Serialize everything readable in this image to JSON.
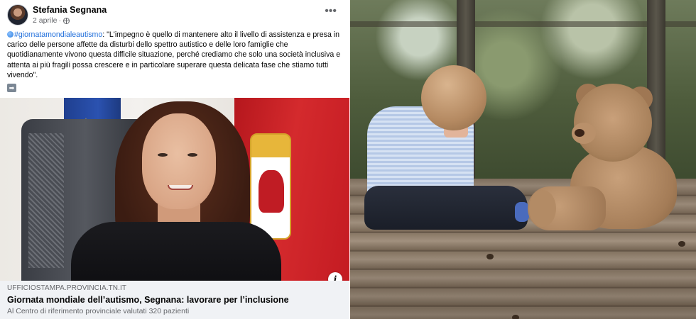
{
  "post": {
    "author": "Stefania Segnana",
    "date": "2 aprile",
    "separator": "·",
    "more_label": "•••",
    "hashtag": "#giornatamondialeautismo",
    "body": ": \"L'impegno è quello di mantenere alto il livello di assistenza e presa in carico delle persone affette da disturbi dello spettro autistico e delle loro famiglie che quotidianamente vivono questa difficile situazione, perché crediamo che solo una società inclusiva e attenta ai più fragili possa crescere e in particolare superare questa delicata fase che stiamo tutti vivendo\".",
    "arrow_glyph": "➡"
  },
  "link_preview": {
    "domain": "UFFICIOSTAMPA.PROVINCIA.TN.IT",
    "title": "Giornata mondiale dell’autismo, Segnana: lavorare per l’inclusione",
    "subtitle": "Al Centro di riferimento provinciale valutati 320 pazienti",
    "info_glyph": "i"
  },
  "colors": {
    "hashtag": "#216fdb",
    "meta_text": "#65676b",
    "caption_bg": "#f0f2f5"
  }
}
